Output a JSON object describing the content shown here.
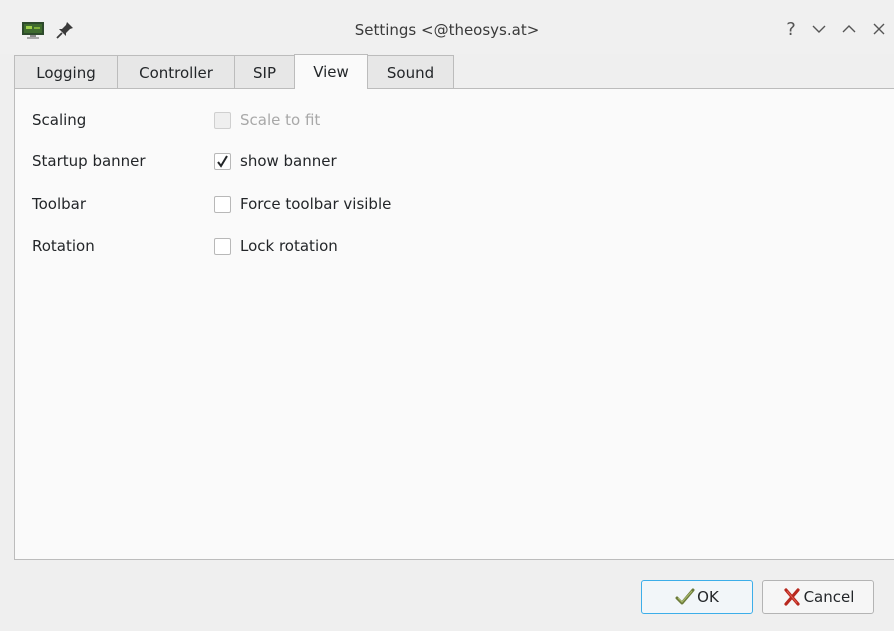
{
  "window": {
    "title": "Settings <@theosys.at>",
    "icons": {
      "app": "monitor-app-icon",
      "pin": "pin-icon",
      "help": "question-mark-icon",
      "minimize": "chevron-down-icon",
      "maximize": "chevron-up-icon",
      "close": "close-icon"
    }
  },
  "tabs": [
    {
      "label": "Logging",
      "active": false
    },
    {
      "label": "Controller",
      "active": false
    },
    {
      "label": "SIP",
      "active": false
    },
    {
      "label": "View",
      "active": true
    },
    {
      "label": "Sound",
      "active": false
    }
  ],
  "view": {
    "scaling": {
      "label": "Scaling",
      "checkbox_label": "Scale to fit",
      "checked": false,
      "enabled": false
    },
    "startup_banner": {
      "label": "Startup banner",
      "checkbox_label": "show banner",
      "checked": true,
      "enabled": true
    },
    "toolbar": {
      "label": "Toolbar",
      "checkbox_label": "Force toolbar visible",
      "checked": false,
      "enabled": true
    },
    "rotation": {
      "label": "Rotation",
      "checkbox_label": "Lock rotation",
      "checked": false,
      "enabled": true
    }
  },
  "buttons": {
    "ok_label": "OK",
    "cancel_label": "Cancel"
  },
  "colors": {
    "focus_accent": "#3daee9",
    "window_bg": "#efefef",
    "panel_bg": "#fafafa"
  }
}
